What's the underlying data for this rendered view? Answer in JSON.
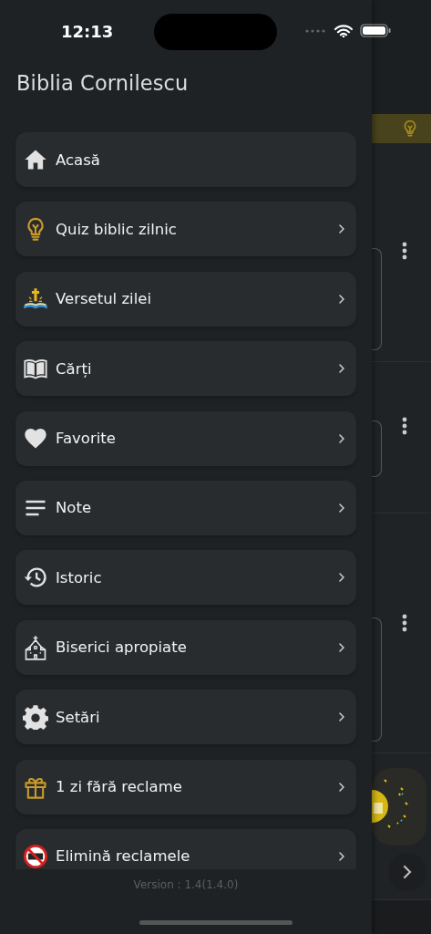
{
  "status_bar": {
    "time": "12:13"
  },
  "drawer": {
    "title": "Biblia Cornilescu",
    "items": [
      {
        "label": "Acasă",
        "kind": "home",
        "chevron": false
      },
      {
        "label": "Quiz biblic zilnic",
        "kind": "bulb",
        "chevron": true
      },
      {
        "label": "Versetul zilei",
        "kind": "bible",
        "chevron": true
      },
      {
        "label": "Cărți",
        "kind": "book",
        "chevron": true
      },
      {
        "label": "Favorite",
        "kind": "heart",
        "chevron": true
      },
      {
        "label": "Note",
        "kind": "lines",
        "chevron": true
      },
      {
        "label": "Istoric",
        "kind": "history",
        "chevron": true
      },
      {
        "label": "Biserici apropiate",
        "kind": "church",
        "chevron": true
      },
      {
        "label": "Setări",
        "kind": "gear",
        "chevron": true
      },
      {
        "label": "1 zi fără reclame",
        "kind": "gift",
        "chevron": true
      },
      {
        "label": "Elimină reclamele",
        "kind": "noads",
        "chevron": true
      }
    ],
    "version": "Version : 1.4(1.4.0)"
  }
}
